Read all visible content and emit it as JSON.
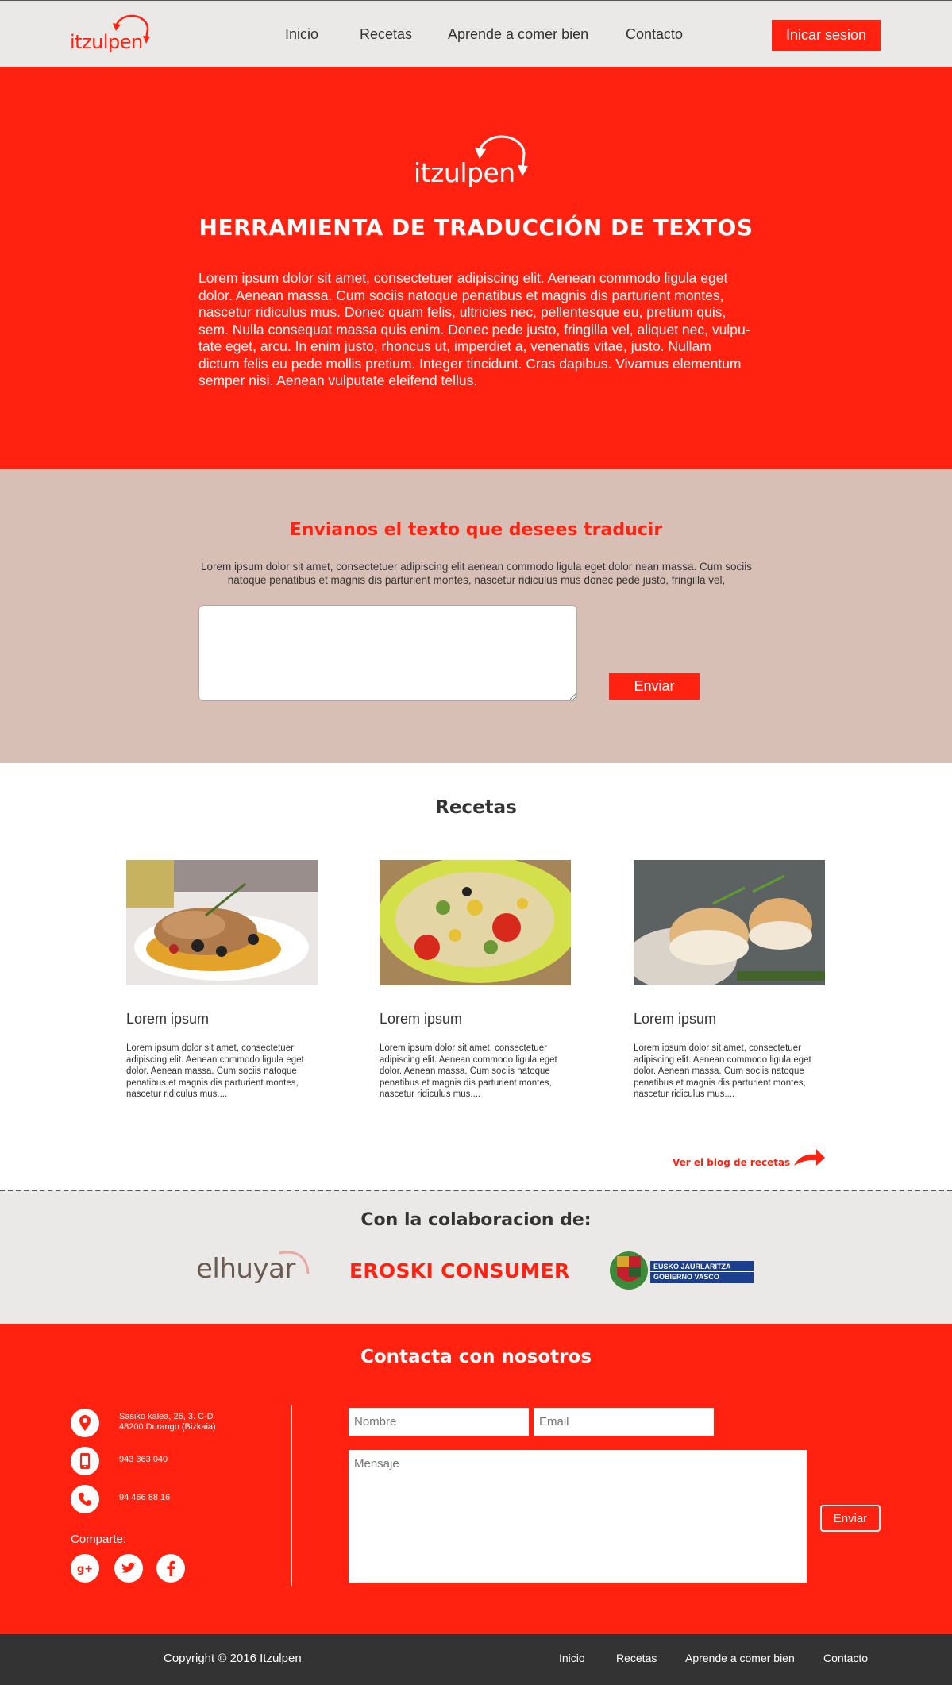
{
  "header": {
    "logo_text": "itzulpen",
    "nav": [
      "Inicio",
      "Recetas",
      "Aprende a comer bien",
      "Contacto"
    ],
    "login_label": "Inicar sesion"
  },
  "hero": {
    "logo_text": "itzulpen",
    "title": "HERRAMIENTA DE TRADUCCIÓN DE TEXTOS",
    "text": "Lorem ipsum dolor sit amet, consectetuer adipiscing elit. Aenean commodo ligula eget dolor. Aenean massa. Cum sociis natoque penatibus et magnis dis parturient montes, nascetur ridiculus mus. Donec quam felis, ultricies nec, pellentesque eu, pretium quis, sem. Nulla consequat massa quis enim. Donec pede justo, fringilla vel, aliquet nec, vulpu-tate eget, arcu. In enim justo, rhoncus ut, imperdiet a, venenatis vitae, justo. Nullam dictum felis eu pede mollis pretium. Integer tincidunt. Cras dapibus. Vivamus elementum semper nisi. Aenean vulputate eleifend tellus."
  },
  "translate": {
    "title": "Envianos el texto que desees traducir",
    "text": "Lorem ipsum dolor sit amet, consectetuer adipiscing elit aenean commodo ligula eget dolor nean massa. Cum sociis natoque penatibus et magnis dis parturient montes, nascetur ridiculus mus donec pede justo, fringilla vel,",
    "send_label": "Enviar"
  },
  "recipes": {
    "title": "Recetas",
    "cards": [
      {
        "title": "Lorem ipsum",
        "text": "Lorem ipsum dolor sit amet, consectetuer adipiscing elit. Aenean commodo ligula eget dolor. Aenean massa. Cum sociis natoque penatibus et magnis dis parturient montes, nascetur ridiculus mus...."
      },
      {
        "title": "Lorem ipsum",
        "text": "Lorem ipsum dolor sit amet, consectetuer adipiscing elit. Aenean commodo ligula eget dolor. Aenean massa. Cum sociis natoque penatibus et magnis dis parturient montes, nascetur ridiculus mus...."
      },
      {
        "title": "Lorem ipsum",
        "text": "Lorem ipsum dolor sit amet, consectetuer adipiscing elit. Aenean commodo ligula eget dolor. Aenean massa. Cum sociis natoque penatibus et magnis dis parturient montes, nascetur ridiculus mus...."
      }
    ],
    "blog_link": "Ver el blog de recetas"
  },
  "collab": {
    "title": "Con la colaboracion de:",
    "partners": [
      "elhuyar",
      "EROSKI CONSUMER"
    ],
    "gov_line1": "EUSKO JAURLARITZA",
    "gov_line2": "GOBIERNO VASCO"
  },
  "contact": {
    "title": "Contacta con nosotros",
    "address_line1": "Sasiko kalea, 26, 3. C-D",
    "address_line2": "48200 Durango (Bizkaia)",
    "phone_mobile": "943 363 040",
    "phone_land": "94 466 88 16",
    "share_label": "Comparte:",
    "name_placeholder": "Nombre",
    "email_placeholder": "Email",
    "message_placeholder": "Mensaje",
    "send_label": "Enviar"
  },
  "footer": {
    "copyright": "Copyright © 2016 Itzulpen",
    "nav": [
      "Inicio",
      "Recetas",
      "Aprende a comer bien",
      "Contacto"
    ]
  },
  "colors": {
    "brand_red": "#ff2211",
    "header_bg": "#ebe9e7",
    "translate_bg": "#d8bfb6",
    "footer_bg": "#333333"
  }
}
